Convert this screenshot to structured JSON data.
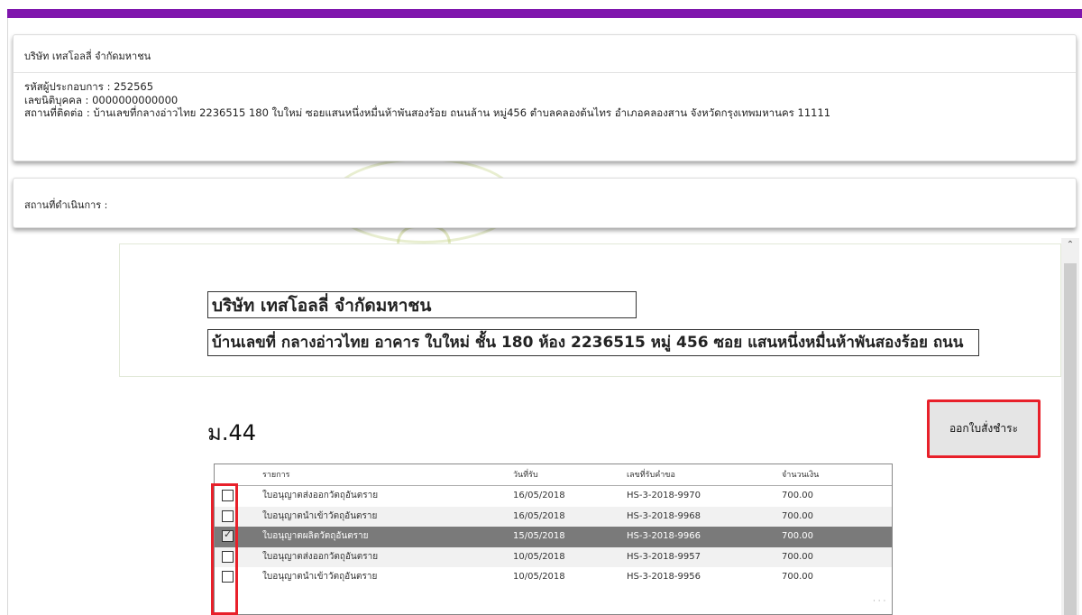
{
  "company_info": {
    "title": "บริษัท เทสโอลลี่ จำกัดมหาชน",
    "operator_code": "รหัสผู้ประกอบการ : 252565",
    "tax_id": "เลขนิติบุคคล : 0000000000000",
    "contact_address": "สถานที่ติดต่อ : บ้านเลขที่กลางอ่าวไทย 2236515 180 ใบใหม่ ซอยแสนหนึ่งหมื่นห้าพันสองร้อย ถนนล้าน หมู่456 ตำบลคลองต้นไทร อำเภอคลองสาน จังหวัดกรุงเทพมหานคร 11111"
  },
  "operating_location": {
    "label": "สถานที่ดำเนินการ :"
  },
  "form": {
    "company_name": "บริษัท เทสโอลลี่ จำกัดมหาชน",
    "address": "บ้านเลขที่ กลางอ่าวไทย อาคาร ใบใหม่ ชั้น 180 ห้อง 2236515 หมู่ 456 ซอย แสนหนึ่งหมื่นห้าพันสองร้อย ถนน"
  },
  "section": {
    "title": "ม.44",
    "action_label": "ออกใบสั่งชำระ"
  },
  "table": {
    "headers": {
      "item": "รายการ",
      "date": "วันที่รับ",
      "request_no": "เลขที่รับคำขอ",
      "amount": "จำนวนเงิน"
    },
    "rows": [
      {
        "checked": false,
        "item": "ใบอนุญาตส่งออกวัตถุอันตราย",
        "date": "16/05/2018",
        "request_no": "HS-3-2018-9970",
        "amount": "700.00"
      },
      {
        "checked": false,
        "item": "ใบอนุญาตนำเข้าวัตถุอันตราย",
        "date": "16/05/2018",
        "request_no": "HS-3-2018-9968",
        "amount": "700.00"
      },
      {
        "checked": true,
        "item": "ใบอนุญาตผลิตวัตถุอันตราย",
        "date": "15/05/2018",
        "request_no": "HS-3-2018-9966",
        "amount": "700.00"
      },
      {
        "checked": false,
        "item": "ใบอนุญาตส่งออกวัตถุอันตราย",
        "date": "10/05/2018",
        "request_no": "HS-3-2018-9957",
        "amount": "700.00"
      },
      {
        "checked": false,
        "item": "ใบอนุญาตนำเข้าวัตถุอันตราย",
        "date": "10/05/2018",
        "request_no": "HS-3-2018-9956",
        "amount": "700.00"
      }
    ]
  },
  "colors": {
    "top_bar": "#7f16ad",
    "highlight": "#e8202a",
    "selected_row": "#7a7a7a"
  },
  "icons": {
    "scroll_up": "chevron-up-icon",
    "checkbox_tick": "check-icon"
  }
}
